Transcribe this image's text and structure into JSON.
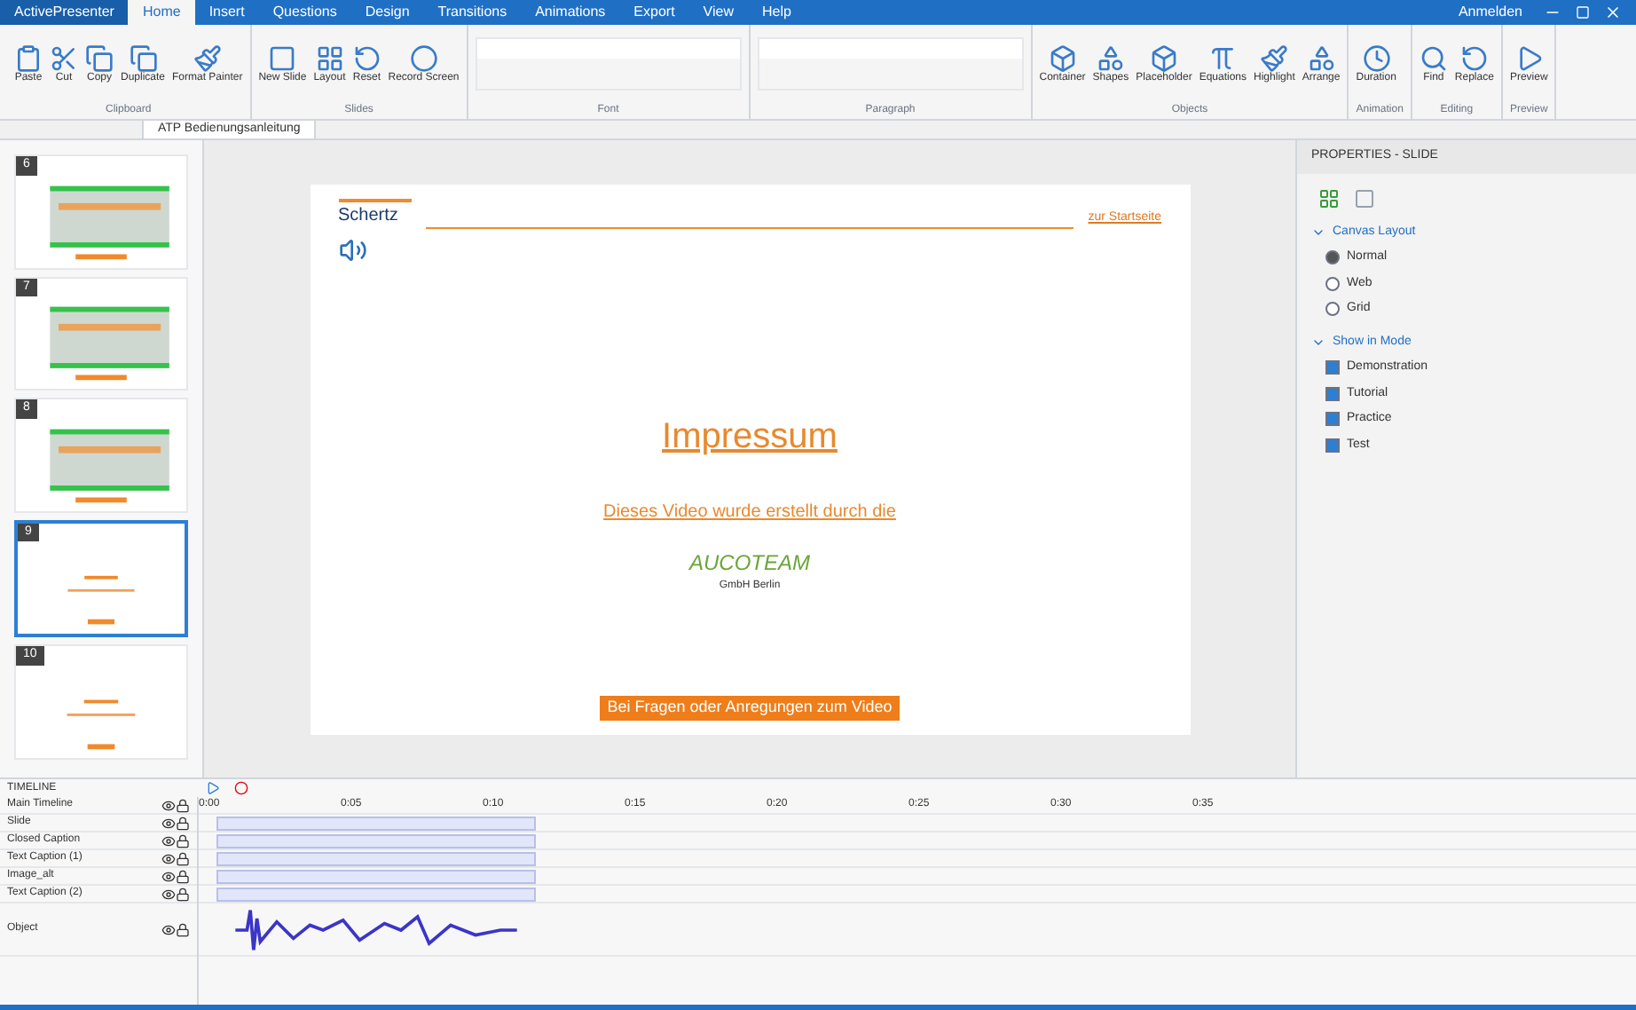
{
  "app_menu": "ActivePresenter",
  "tabs": [
    {
      "label": "Home",
      "selected": true
    },
    {
      "label": "Insert",
      "selected": false
    },
    {
      "label": "Questions",
      "selected": false
    },
    {
      "label": "Design",
      "selected": false
    },
    {
      "label": "Transitions",
      "selected": false
    },
    {
      "label": "Animations",
      "selected": false
    },
    {
      "label": "Export",
      "selected": false
    },
    {
      "label": "View",
      "selected": false
    },
    {
      "label": "Help",
      "selected": false
    }
  ],
  "account": "Anmelden",
  "ribbon_groups": [
    {
      "name": "Clipboard",
      "buttons": [
        "Paste",
        "Cut",
        "Copy",
        "Duplicate",
        "Format Painter"
      ]
    },
    {
      "name": "Slides",
      "buttons": [
        "New Slide",
        "Layout",
        "Reset",
        "Record Screen"
      ]
    },
    {
      "name": "Font"
    },
    {
      "name": "Paragraph"
    },
    {
      "name": "Objects",
      "buttons": [
        "Container",
        "Shapes",
        "Placeholder",
        "Equations",
        "Highlight",
        "Arrange"
      ]
    },
    {
      "name": "Animation",
      "buttons": [
        "Duration"
      ]
    },
    {
      "name": "Editing",
      "buttons": [
        "Find",
        "Replace"
      ]
    },
    {
      "name": "Preview",
      "buttons": [
        "Preview"
      ]
    }
  ],
  "document_tab": "ATP Bedienungsanleitung",
  "slides": [
    {
      "number": "6",
      "selected": false,
      "kind": "table"
    },
    {
      "number": "7",
      "selected": false,
      "kind": "table"
    },
    {
      "number": "8",
      "selected": false,
      "kind": "table"
    },
    {
      "number": "9",
      "selected": true,
      "kind": "text"
    },
    {
      "number": "10",
      "selected": false,
      "kind": "text"
    }
  ],
  "slide": {
    "logo": "Schertz",
    "header_link": "zur Startseite",
    "title": "Impressum",
    "body": "Dieses Video wurde erstellt durch die",
    "partner_logo": "AUCOTEAM",
    "partner_sub": "GmbH Berlin",
    "footer_button": "Bei Fragen oder Anregungen zum Video"
  },
  "properties": {
    "title": "PROPERTIES - SLIDE",
    "sections": [
      {
        "title": "Canvas Layout",
        "expanded": true,
        "items": [
          {
            "kind": "radio",
            "label": "Normal",
            "selected": true
          },
          {
            "kind": "radio",
            "label": "Web",
            "selected": false
          },
          {
            "kind": "radio",
            "label": "Grid",
            "selected": false
          }
        ]
      },
      {
        "title": "Show in Mode",
        "expanded": true,
        "items": [
          {
            "kind": "check",
            "label": "Demonstration",
            "checked": true
          },
          {
            "kind": "check",
            "label": "Tutorial",
            "checked": true
          },
          {
            "kind": "check",
            "label": "Practice",
            "checked": true
          },
          {
            "kind": "check",
            "label": "Test",
            "checked": true
          }
        ]
      }
    ]
  },
  "timeline": {
    "title": "TIMELINE",
    "ticks": [
      "0:00",
      "0:05",
      "0:10",
      "0:15",
      "0:20",
      "0:25",
      "0:30",
      "0:35"
    ],
    "tracks": [
      {
        "name": "Main Timeline",
        "kind": "main"
      },
      {
        "name": "Slide",
        "kind": "bar"
      },
      {
        "name": "Closed Caption",
        "kind": "bar"
      },
      {
        "name": "Text Caption (1)",
        "kind": "bar"
      },
      {
        "name": "Image_alt",
        "kind": "bar"
      },
      {
        "name": "Text Caption (2)",
        "kind": "bar"
      },
      {
        "name": "Object",
        "kind": "audio"
      }
    ]
  }
}
